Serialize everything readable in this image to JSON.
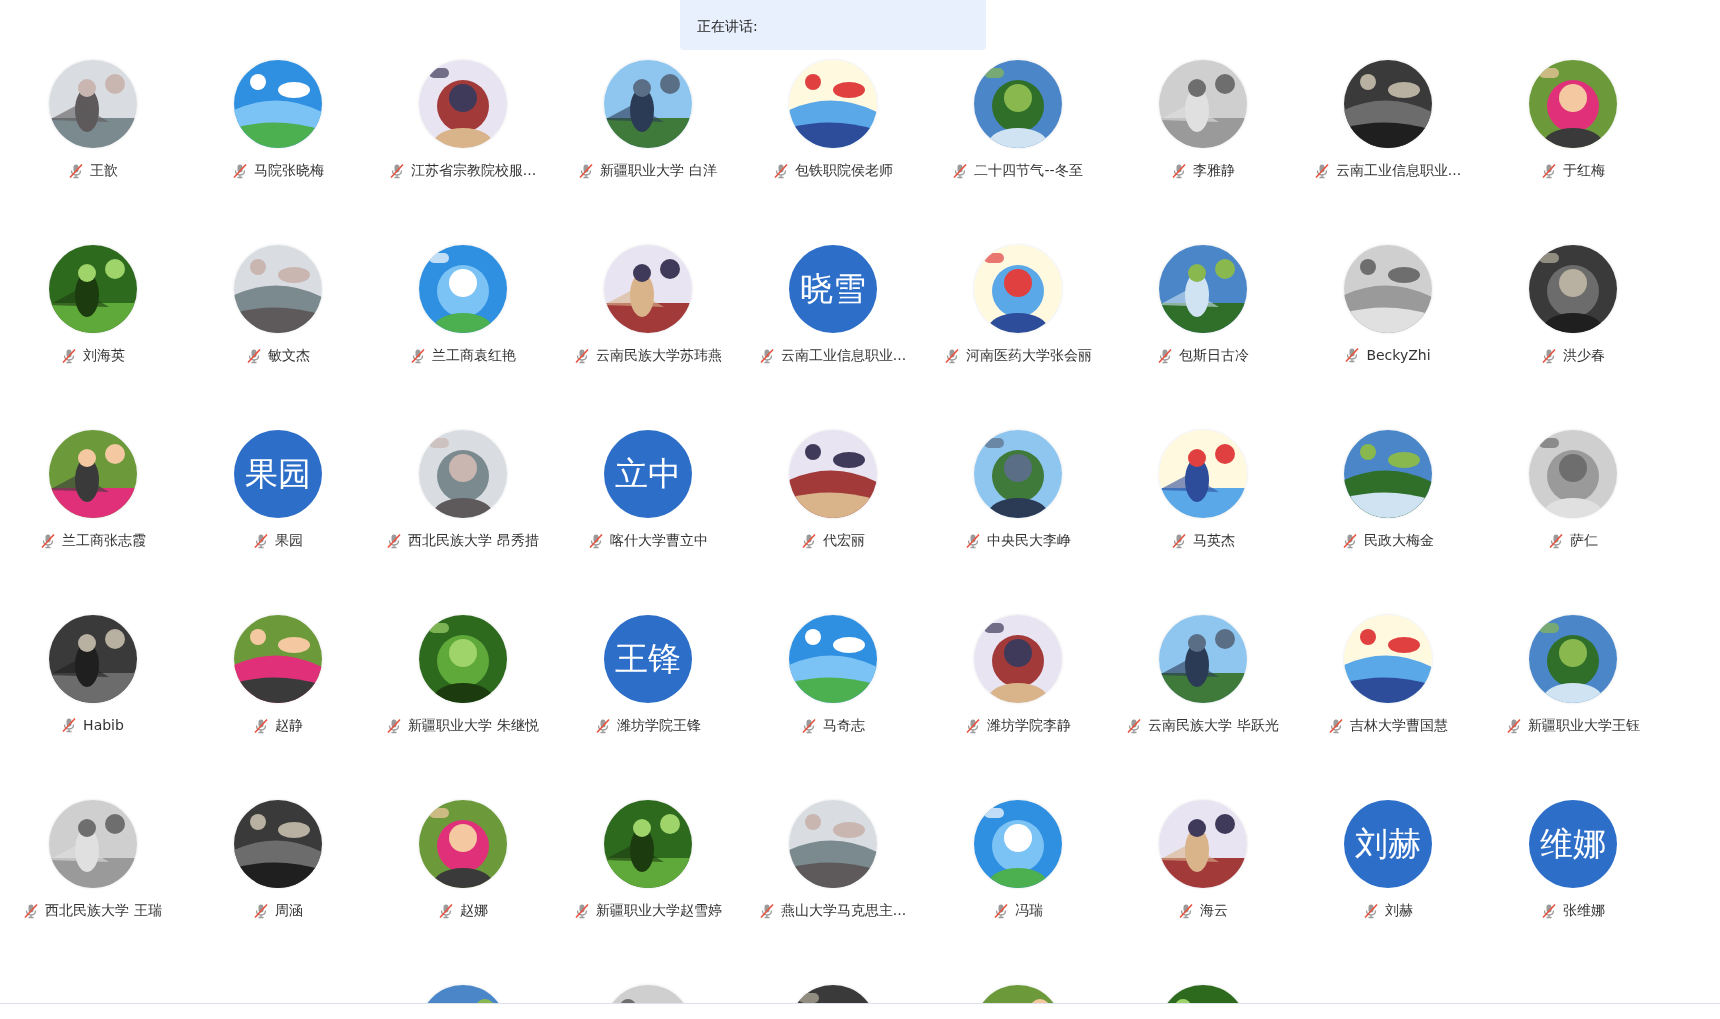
{
  "speaking_banner": {
    "label": "正在讲话:"
  },
  "participants": [
    {
      "name": "王歆",
      "kind": "picture",
      "muted": true
    },
    {
      "name": "马院张晓梅",
      "kind": "picture",
      "muted": true
    },
    {
      "name": "江苏省宗教院校服...",
      "kind": "picture",
      "muted": true
    },
    {
      "name": "新疆职业大学  白洋",
      "kind": "picture",
      "muted": true
    },
    {
      "name": "包铁职院侯老师",
      "kind": "picture",
      "muted": true
    },
    {
      "name": "二十四节气--冬至",
      "kind": "picture",
      "muted": true
    },
    {
      "name": "李雅静",
      "kind": "picture",
      "muted": true
    },
    {
      "name": "云南工业信息职业...",
      "kind": "picture",
      "muted": true
    },
    {
      "name": "于红梅",
      "kind": "picture",
      "muted": true
    },
    {
      "name": "刘海英",
      "kind": "picture",
      "muted": true
    },
    {
      "name": "敏文杰",
      "kind": "picture",
      "muted": true
    },
    {
      "name": "兰工商袁红艳",
      "kind": "picture",
      "muted": true
    },
    {
      "name": "云南民族大学苏玮燕",
      "kind": "picture",
      "muted": true
    },
    {
      "name": "云南工业信息职业...",
      "kind": "text",
      "initials": "晓雪",
      "muted": true
    },
    {
      "name": "河南医药大学张会丽",
      "kind": "picture",
      "muted": true
    },
    {
      "name": "包斯日古冷",
      "kind": "picture",
      "muted": true
    },
    {
      "name": "BeckyZhi",
      "kind": "picture",
      "muted": true
    },
    {
      "name": "洪少春",
      "kind": "picture",
      "muted": true
    },
    {
      "name": "兰工商张志霞",
      "kind": "picture",
      "muted": true
    },
    {
      "name": "果园",
      "kind": "text",
      "initials": "果园",
      "muted": true
    },
    {
      "name": "西北民族大学 昂秀措",
      "kind": "picture",
      "muted": true
    },
    {
      "name": "喀什大学曹立中",
      "kind": "text",
      "initials": "立中",
      "muted": true
    },
    {
      "name": "代宏丽",
      "kind": "picture",
      "muted": true
    },
    {
      "name": "中央民大李峥",
      "kind": "picture",
      "muted": true
    },
    {
      "name": "马英杰",
      "kind": "picture",
      "muted": true
    },
    {
      "name": "民政大梅金",
      "kind": "picture",
      "muted": true
    },
    {
      "name": "萨仁",
      "kind": "picture",
      "muted": true
    },
    {
      "name": "Habib",
      "kind": "picture",
      "muted": true
    },
    {
      "name": "赵静",
      "kind": "picture",
      "muted": true
    },
    {
      "name": "新疆职业大学 朱继悦",
      "kind": "picture",
      "muted": true
    },
    {
      "name": "潍坊学院王锋",
      "kind": "text",
      "initials": "王锋",
      "muted": true
    },
    {
      "name": "马奇志",
      "kind": "picture",
      "muted": true
    },
    {
      "name": "潍坊学院李静",
      "kind": "picture",
      "muted": true
    },
    {
      "name": "云南民族大学 毕跃光",
      "kind": "picture",
      "muted": true
    },
    {
      "name": "吉林大学曹国慧",
      "kind": "picture",
      "muted": true
    },
    {
      "name": "新疆职业大学王钰",
      "kind": "picture",
      "muted": true
    },
    {
      "name": "西北民族大学 王瑞",
      "kind": "picture",
      "muted": true
    },
    {
      "name": "周涵",
      "kind": "picture",
      "muted": true
    },
    {
      "name": "赵娜",
      "kind": "picture",
      "muted": true
    },
    {
      "name": "新疆职业大学赵雪婷",
      "kind": "picture",
      "muted": true
    },
    {
      "name": "燕山大学马克思主...",
      "kind": "picture",
      "muted": true
    },
    {
      "name": "冯瑞",
      "kind": "picture",
      "muted": true
    },
    {
      "name": "海云",
      "kind": "picture",
      "muted": true
    },
    {
      "name": "刘赫",
      "kind": "text",
      "initials": "刘赫",
      "muted": true
    },
    {
      "name": "张维娜",
      "kind": "text",
      "initials": "维娜",
      "muted": true
    },
    {
      "kind": "picture"
    },
    {
      "kind": "picture"
    },
    {
      "kind": "picture"
    },
    {
      "kind": "picture"
    },
    {
      "kind": "picture"
    }
  ]
}
